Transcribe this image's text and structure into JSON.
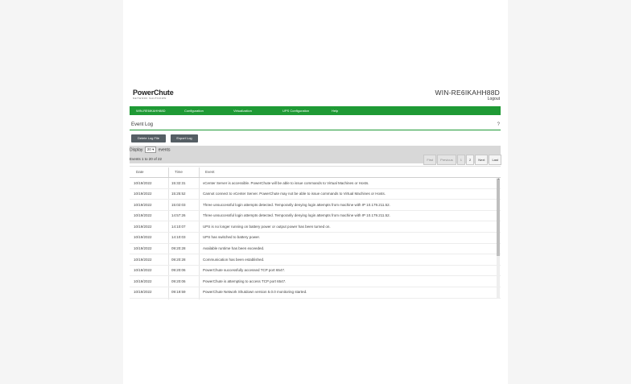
{
  "header": {
    "logo_name": "PowerChute",
    "logo_sub": "NETWORK SHUTDOWN",
    "hostname": "WIN-RE6IKAHH88D",
    "logout": "Logout"
  },
  "nav": {
    "items": [
      "WIN-RE6IKAHH88D",
      "Configuration",
      "Virtualization",
      "UPS Configuration",
      "Help"
    ]
  },
  "page": {
    "title": "Event Log",
    "help": "?"
  },
  "buttons": {
    "delete": "Delete Log File",
    "export": "Export Log"
  },
  "display": {
    "prefix": "Display",
    "value": "20",
    "suffix": "events",
    "count": "Events 1 to 20 of 22"
  },
  "pager": {
    "first": "First",
    "previous": "Previous",
    "page1": "1",
    "page2": "2",
    "next": "Next",
    "last": "Last"
  },
  "table": {
    "columns": [
      "Date",
      "Time",
      "Event"
    ],
    "rows": [
      [
        "10/19/2022",
        "15:32:31",
        "vCenter Server is accessible. PowerChute will be able to issue commands to Virtual Machines or Hosts."
      ],
      [
        "10/19/2022",
        "15:25:52",
        "Cannot connect to vCenter Server. PowerChute may not be able to issue commands to Virtual Machines or Hosts."
      ],
      [
        "10/19/2022",
        "15:02:03",
        "Three unsuccessful login attempts detected. Temporarily denying login attempts from machine with IP 10.179.211.52."
      ],
      [
        "10/19/2022",
        "14:57:26",
        "Three unsuccessful login attempts detected. Temporarily denying login attempts from machine with IP 10.179.211.52."
      ],
      [
        "10/19/2022",
        "14:10:07",
        "UPS is no longer running on battery power or output power has been turned on."
      ],
      [
        "10/19/2022",
        "14:10:03",
        "UPS has switched to battery power."
      ],
      [
        "10/19/2022",
        "09:20:28",
        "Available runtime has been exceeded."
      ],
      [
        "10/19/2022",
        "09:20:28",
        "Communication has been established."
      ],
      [
        "10/19/2022",
        "09:20:06",
        "PowerChute successfully accessed TCP port 6547."
      ],
      [
        "10/19/2022",
        "09:20:06",
        "PowerChute is attempting to access TCP port 6547."
      ],
      [
        "10/19/2022",
        "09:19:59",
        "PowerChute Network Shutdown version 5.0.0 monitoring started."
      ],
      [
        "10/19/2022",
        "09:19:58",
        "PowerChute successfully accessed UDP port 3052."
      ]
    ]
  }
}
